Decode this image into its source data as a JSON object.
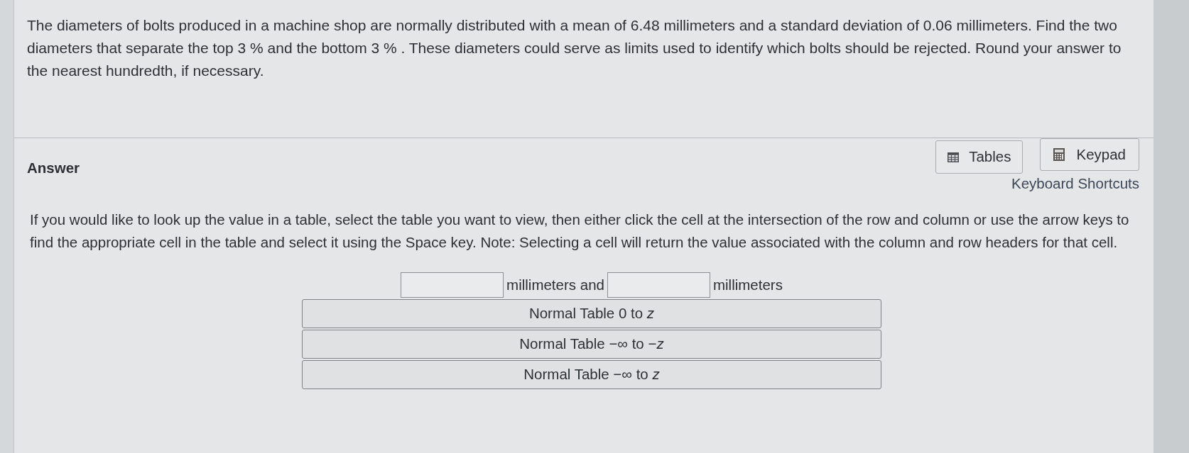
{
  "question": {
    "text": "The diameters of bolts produced in a machine shop are normally distributed with a mean of 6.48 millimeters and a standard deviation of 0.06 millimeters.  Find the two diameters that separate the top 3 %  and the bottom 3 % .  These diameters could serve as limits used to identify which bolts should be rejected.  Round your answer to the nearest hundredth, if necessary."
  },
  "answer": {
    "heading": "Answer",
    "tools": [
      {
        "kind": "tables",
        "label": "Tables"
      },
      {
        "kind": "keypad",
        "label": "Keypad"
      }
    ],
    "shortcuts_link": "Keyboard Shortcuts",
    "instructions": "If you would like to look up the value in a table, select the table you want to view, then either click the cell at the intersection of the row and column or use the arrow keys to find the appropriate cell in the table and select it using the Space key. Note: Selecting a cell will return the value associated with the column and row headers for that cell.",
    "response": [
      {
        "kind": "blank"
      },
      {
        "kind": "label",
        "text": "millimeters and"
      },
      {
        "kind": "blank"
      },
      {
        "kind": "label",
        "text": "millimeters"
      }
    ],
    "table_buttons": [
      "Normal Table 0 to *z*",
      "Normal Table −∞ to −*z*",
      "Normal Table −∞ to *z*"
    ]
  }
}
